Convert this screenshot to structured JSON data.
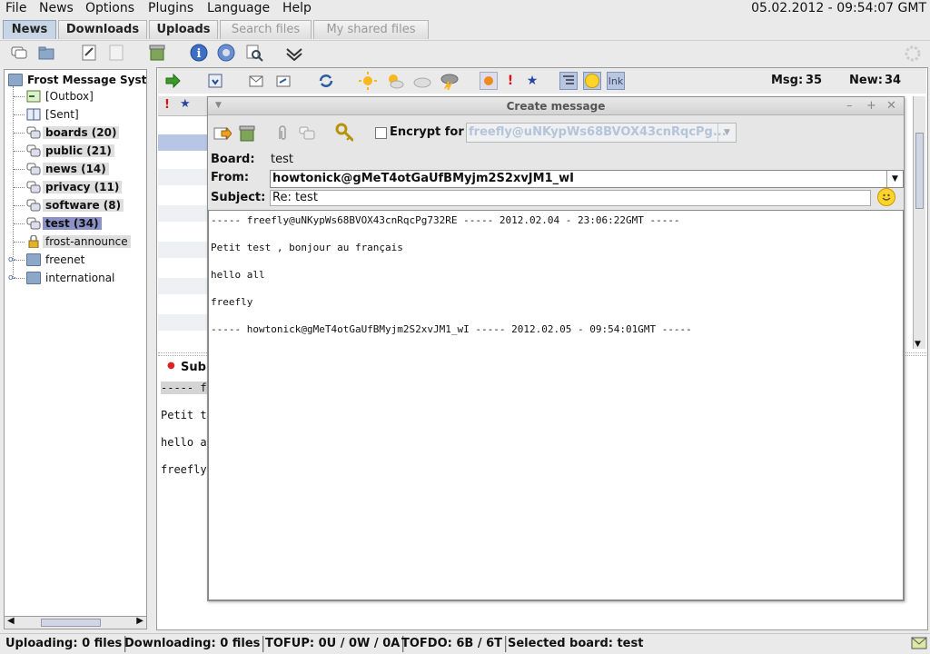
{
  "menu": [
    "File",
    "News",
    "Options",
    "Plugins",
    "Language",
    "Help"
  ],
  "clock": "05.02.2012 - 09:54:07 GMT",
  "tabs": [
    {
      "label": "News",
      "state": "active"
    },
    {
      "label": "Downloads",
      "state": "normal"
    },
    {
      "label": "Uploads",
      "state": "normal"
    },
    {
      "label": "Search files",
      "state": "disabled"
    },
    {
      "label": "My shared files",
      "state": "disabled"
    }
  ],
  "tree": {
    "root": "Frost Message System",
    "items": [
      {
        "label": "[Outbox]",
        "bold": false
      },
      {
        "label": "[Sent]",
        "bold": false
      },
      {
        "label": "boards (20)",
        "bold": true
      },
      {
        "label": "public (21)",
        "bold": true
      },
      {
        "label": "news (14)",
        "bold": true
      },
      {
        "label": "privacy (11)",
        "bold": true
      },
      {
        "label": "software (8)",
        "bold": true
      },
      {
        "label": "test (34)",
        "bold": true,
        "selected": true
      },
      {
        "label": "frost-announce",
        "bold": false
      },
      {
        "label": "freenet",
        "bold": false
      },
      {
        "label": "international",
        "bold": false
      }
    ]
  },
  "counters": {
    "msg_label": "Msg:",
    "msg": "35",
    "new_label": "New:",
    "new": "34"
  },
  "link_label": "lnk",
  "create_message": {
    "title": "Create message",
    "encrypt_label": "Encrypt for",
    "encrypt_value": "freefly@uNKypWs68BVOX43cnRqcPg...",
    "board_label": "Board:",
    "board_value": "test",
    "from_label": "From:",
    "from_value": "howtonick@gMeT4otGaUfBMyjm2S2xvJM1_wI",
    "subject_label": "Subject:",
    "subject_value": "Re: test",
    "body_lines": [
      "----- freefly@uNKypWs68BVOX43cnRqcPg732RE ----- 2012.02.04 - 23:06:22GMT -----",
      "",
      "Petit test , bonjour au français",
      "",
      "hello all",
      "",
      "freefly",
      "",
      "----- howtonick@gMeT4otGaUfBMyjm2S2xvJM1_wI ----- 2012.02.05 - 09:54:01GMT -----"
    ]
  },
  "preview": {
    "subject_label": "Sub",
    "lines": [
      "----- f",
      "Petit t",
      "hello a",
      "freefly"
    ]
  },
  "statusbar": {
    "uploading": "Uploading: 0 files",
    "downloading": "Downloading: 0 files",
    "tofup": "TOFUP: 0U / 0W / 0A",
    "tofdo": "TOFDO: 6B / 6T",
    "board": "Selected board: test"
  },
  "colors": {
    "selected": "#8c92c7",
    "accent_tab": "#c7d5e4",
    "encrypt_disabled": "#b5c4d8"
  }
}
